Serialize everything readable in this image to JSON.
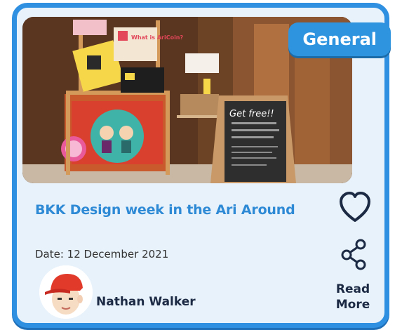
{
  "card": {
    "category_tag": "General",
    "title": "BKK Design week in the Ari Around",
    "date": "Date: 12 December 2021",
    "author": "Nathan Walker",
    "read_more": "Read\nMore"
  },
  "photo": {
    "signs": {
      "chalkboard": "Get free!!",
      "ad_board": "What is AriCoin?"
    }
  },
  "icons": {
    "favorite": "heart-icon",
    "share": "share-icon"
  },
  "colors": {
    "accent": "#2f8fe0",
    "title": "#2f8ad6",
    "card_bg": "#e7f2fb",
    "text_dark": "#1d2a44"
  }
}
